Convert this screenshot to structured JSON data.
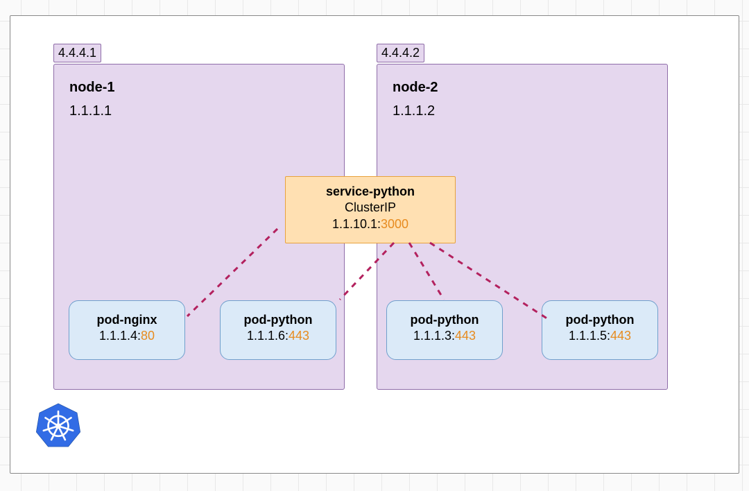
{
  "nodes": [
    {
      "name": "node-1",
      "ip": "1.1.1.1",
      "external_ip": "4.4.4.1"
    },
    {
      "name": "node-2",
      "ip": "1.1.1.2",
      "external_ip": "4.4.4.2"
    }
  ],
  "service": {
    "name": "service-python",
    "type": "ClusterIP",
    "ip": "1.1.10.1",
    "port": "3000"
  },
  "pods": [
    {
      "name": "pod-nginx",
      "ip": "1.1.1.4",
      "port": "80"
    },
    {
      "name": "pod-python",
      "ip": "1.1.1.6",
      "port": "443"
    },
    {
      "name": "pod-python",
      "ip": "1.1.1.3",
      "port": "443"
    },
    {
      "name": "pod-python",
      "ip": "1.1.1.5",
      "port": "443"
    }
  ],
  "colors": {
    "node_fill": "#e5d7ee",
    "node_border": "#8e6ca8",
    "svc_fill": "#ffe0b2",
    "svc_border": "#e8a23d",
    "pod_fill": "#dbeaf8",
    "pod_border": "#6f9fcc",
    "port": "#e78b1f",
    "connector": "#b3215e"
  },
  "icons": {
    "kubernetes": "kubernetes-logo"
  }
}
